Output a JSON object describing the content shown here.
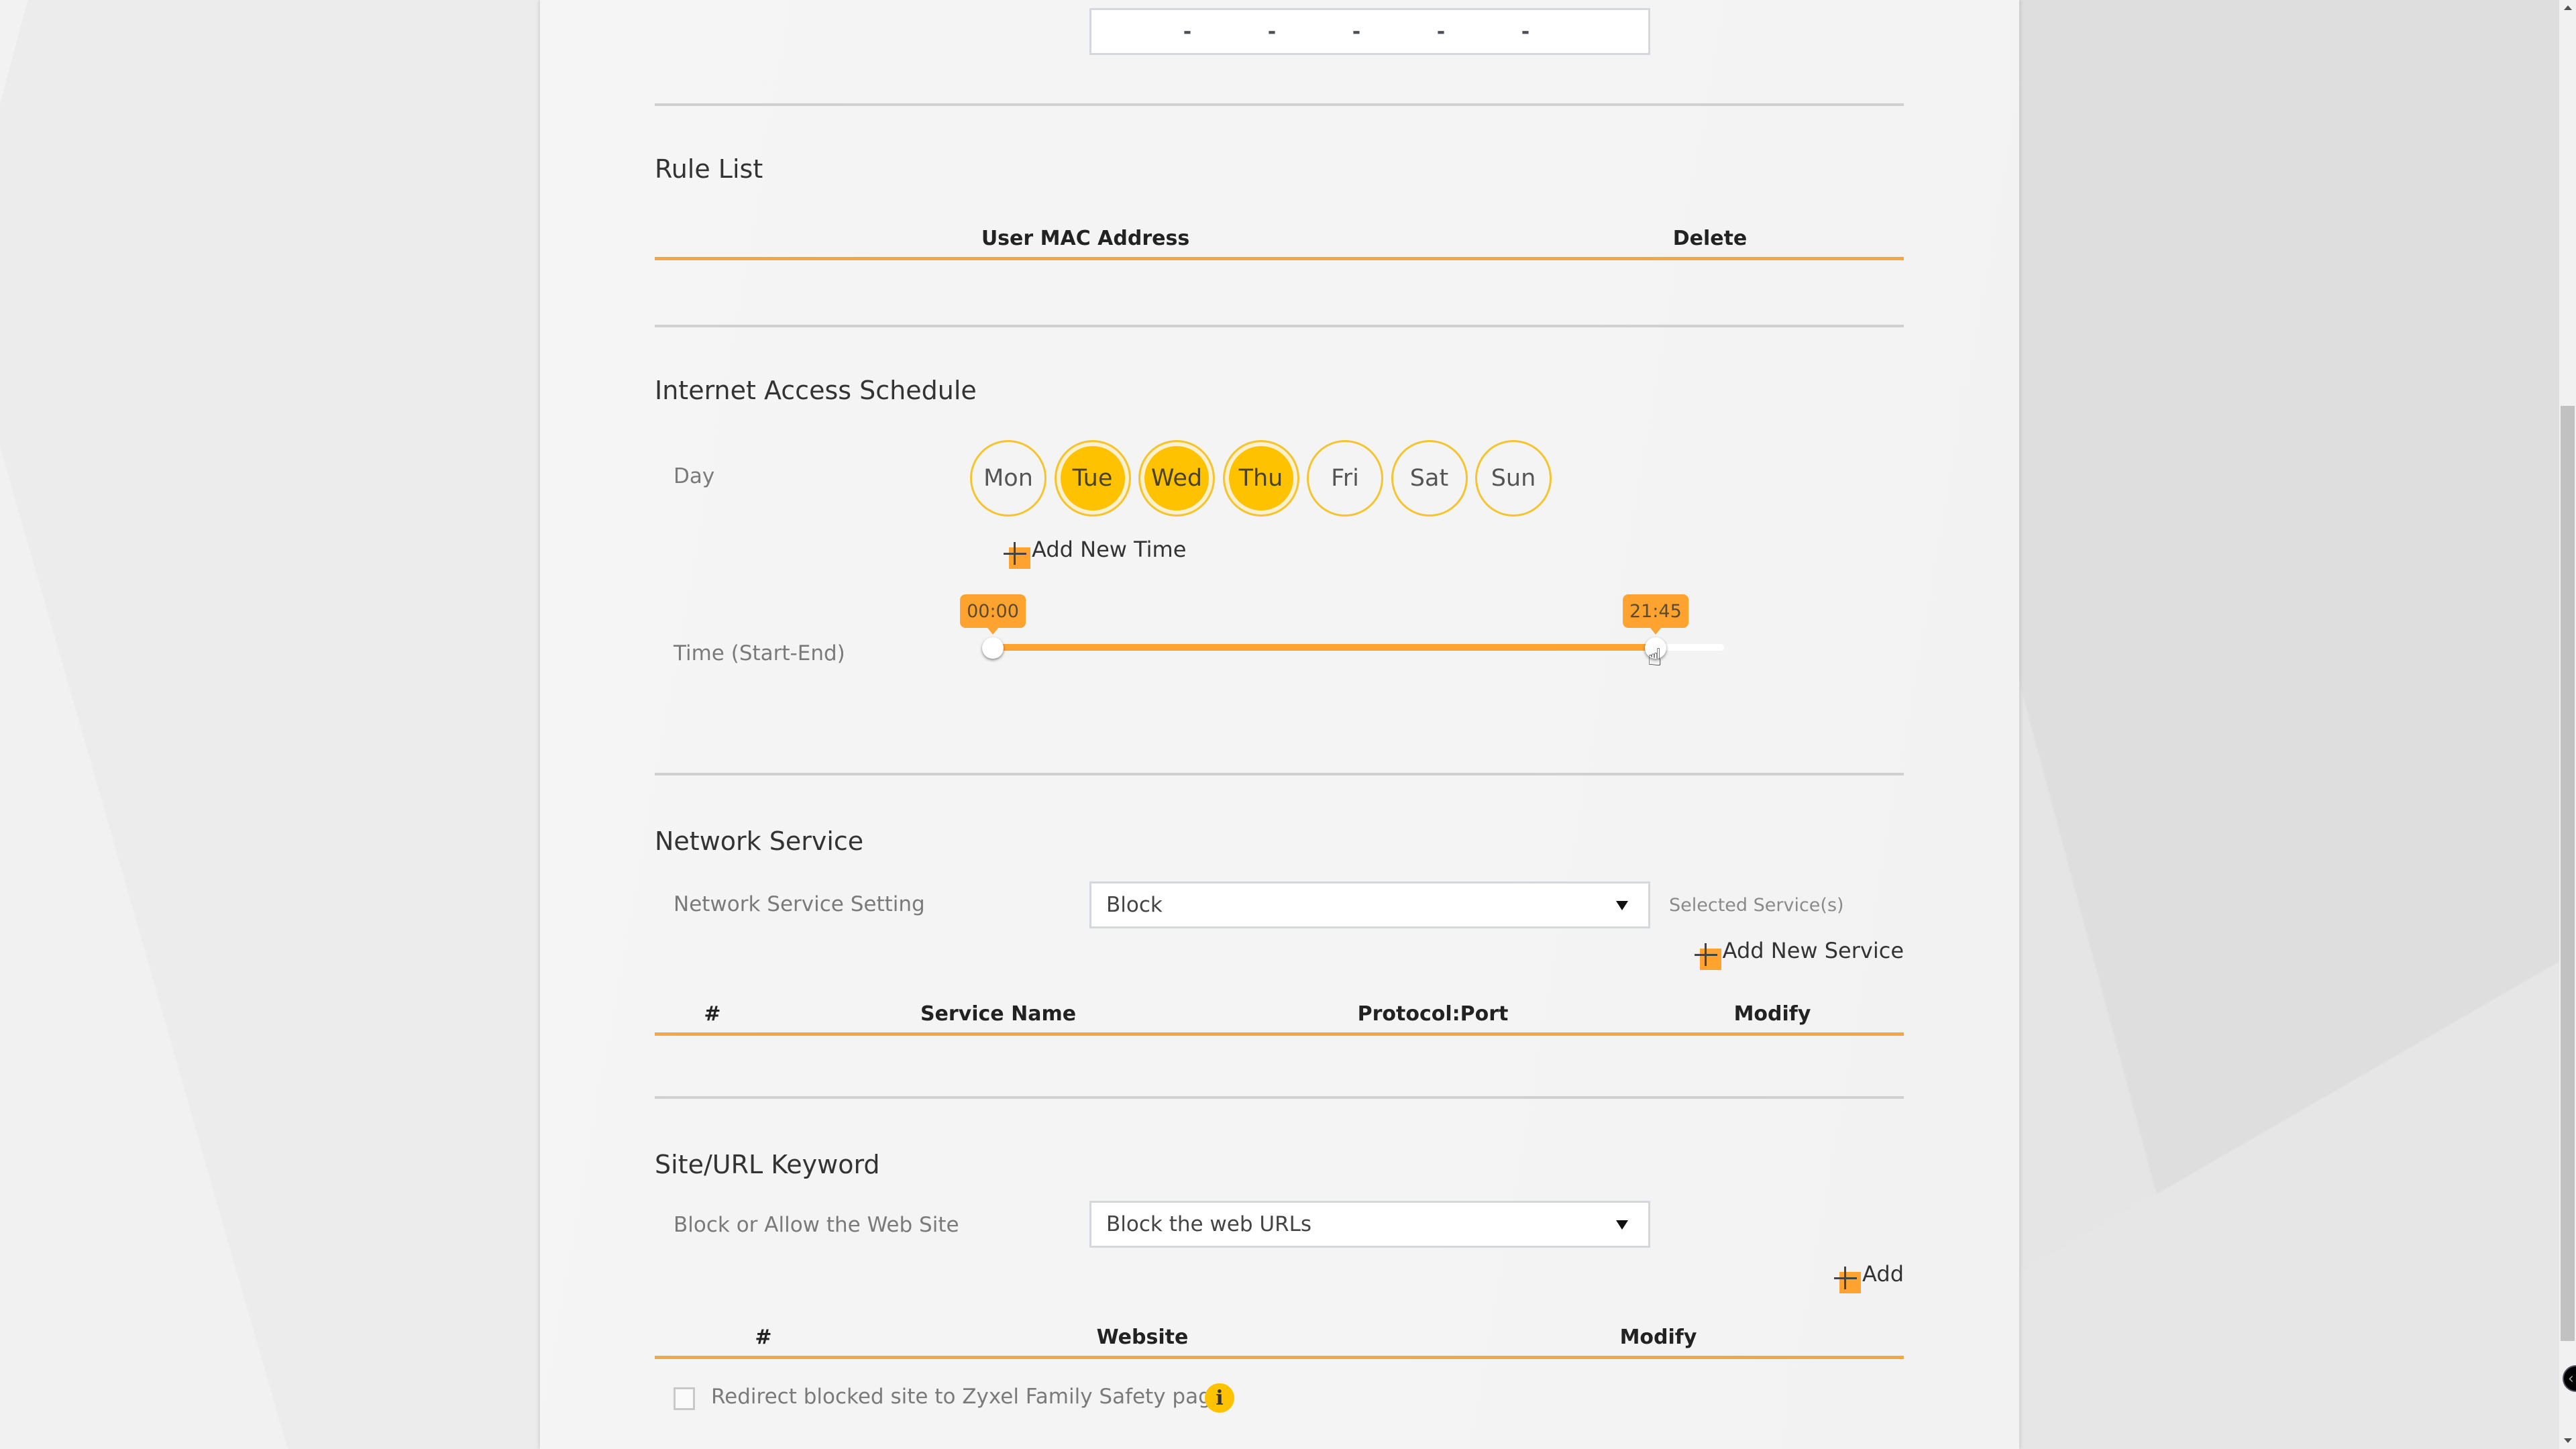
{
  "ip_field": {
    "separators": [
      "-",
      "-",
      "-",
      "-",
      "-"
    ]
  },
  "rule_list": {
    "title": "Rule List",
    "columns": [
      "User MAC Address",
      "Delete"
    ],
    "rows": []
  },
  "schedule": {
    "title": "Internet Access Schedule",
    "day_label": "Day",
    "days": [
      {
        "label": "Mon",
        "selected": false
      },
      {
        "label": "Tue",
        "selected": true
      },
      {
        "label": "Wed",
        "selected": true
      },
      {
        "label": "Thu",
        "selected": true
      },
      {
        "label": "Fri",
        "selected": false
      },
      {
        "label": "Sat",
        "selected": false
      },
      {
        "label": "Sun",
        "selected": false
      }
    ],
    "add_time_label": "Add New Time",
    "time_label": "Time (Start-End)",
    "time_start": "00:00",
    "time_end": "21:45",
    "time_start_fraction": 0.0,
    "time_end_fraction": 0.9063
  },
  "network_service": {
    "title": "Network Service",
    "setting_label": "Network Service Setting",
    "setting_value": "Block",
    "selected_services_label": "Selected Service(s)",
    "add_service_label": "Add New Service",
    "columns": [
      "#",
      "Service Name",
      "Protocol:Port",
      "Modify"
    ],
    "rows": []
  },
  "site_url": {
    "title": "Site/URL Keyword",
    "block_allow_label": "Block or Allow the Web Site",
    "block_allow_value": "Block the web URLs",
    "add_label": "Add",
    "columns": [
      "#",
      "Website",
      "Modify"
    ],
    "rows": [],
    "redirect_label": "Redirect blocked site to Zyxel Family Safety page",
    "redirect_checked": false
  },
  "colors": {
    "accent_orange": "#ffa330",
    "day_selected": "#ffc200",
    "table_rule": "#f5a544"
  },
  "scrollbar": {
    "scroll_position_fraction": 0.28
  }
}
